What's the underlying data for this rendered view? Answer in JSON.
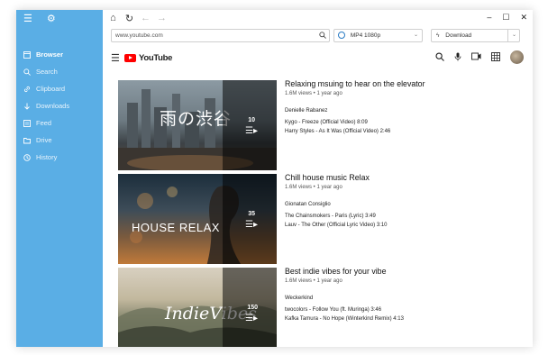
{
  "sidebar": {
    "items": [
      {
        "label": "Browser",
        "icon": "browser-icon"
      },
      {
        "label": "Search",
        "icon": "search-icon"
      },
      {
        "label": "Clipboard",
        "icon": "clipboard-icon"
      },
      {
        "label": "Downloads",
        "icon": "download-icon"
      },
      {
        "label": "Feed",
        "icon": "feed-icon"
      },
      {
        "label": "Drive",
        "icon": "folder-icon"
      },
      {
        "label": "History",
        "icon": "history-icon"
      }
    ]
  },
  "address": {
    "url": "www.youtube.com"
  },
  "format": {
    "value": "MP4 1080p"
  },
  "download": {
    "label": "Download"
  },
  "youtube": {
    "logo": "YouTube"
  },
  "accent": "#5aaee5",
  "videos": [
    {
      "title": "Relaxing msuing to hear on the elevator",
      "meta": "1.6M views • 1 year ago",
      "channel": "Denielle Rabanez",
      "count": "10",
      "thumb_text": "雨の渋谷",
      "tracks": [
        "Kygo - Freeze (Official Video) 8:09",
        "Harry Styles - As It Was (Official Video) 2:46"
      ]
    },
    {
      "title": "Chill house music Relax",
      "meta": "1.6M views • 1 year ago",
      "channel": "Gionatan Consiglio",
      "count": "35",
      "thumb_text": "HOUSE RELAX",
      "tracks": [
        "The Chainsmokers - Paris (Lyric) 3:49",
        "Lauv - The Other (Official Lyric Video) 3:10"
      ]
    },
    {
      "title": "Best indie vibes for your vibe",
      "meta": "1.6M views • 1 year ago",
      "channel": "Weckerkind",
      "count": "150",
      "thumb_text": "IndieVibes",
      "tracks": [
        "twocolors - Follow You (ft. Muringa) 3:46",
        "Kafka Tamura - No Hope (Winterkind Remix) 4:13"
      ]
    }
  ]
}
